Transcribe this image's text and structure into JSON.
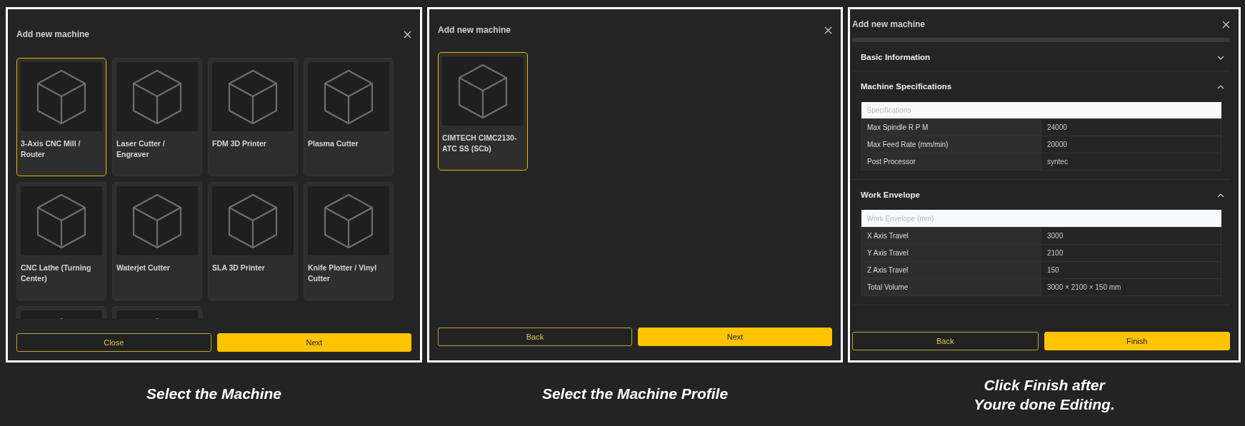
{
  "panels": [
    {
      "kind": "card_grid",
      "title": "Add new machine",
      "cards": [
        {
          "label": "3-Axis CNC Mill / Router",
          "selected": true
        },
        {
          "label": "Laser Cutter / Engraver",
          "selected": false
        },
        {
          "label": "FDM 3D Printer",
          "selected": false
        },
        {
          "label": "Plasma Cutter",
          "selected": false
        },
        {
          "label": "CNC Lathe (Turning Center)",
          "selected": false
        },
        {
          "label": "Waterjet Cutter",
          "selected": false
        },
        {
          "label": "SLA 3D Printer",
          "selected": false
        },
        {
          "label": "Knife Plotter / Vinyl Cutter",
          "selected": false
        },
        {
          "selected": false
        },
        {
          "selected": false
        }
      ],
      "buttons": [
        {
          "label": "Close",
          "kind": "outline"
        },
        {
          "label": "Next",
          "kind": "primary"
        }
      ],
      "caption": [
        "Select the Machine"
      ]
    },
    {
      "kind": "card_grid",
      "title": "Add new machine",
      "cards": [
        {
          "label": "CIMTECH CIMC2130-ATC SS (SCb)",
          "selected": true
        }
      ],
      "buttons": [
        {
          "label": "Back",
          "kind": "outline"
        },
        {
          "label": "Next",
          "kind": "primary"
        }
      ],
      "caption": [
        "Select the Machine Profile"
      ]
    },
    {
      "kind": "details",
      "title": "Add new machine",
      "sections": [
        {
          "title": "Basic Information",
          "expanded": false
        },
        {
          "title": "Machine Specifications",
          "expanded": true,
          "table": {
            "header": "Specifications",
            "rows": [
              [
                "Max Spindle R P M",
                "24000"
              ],
              [
                "Max Feed Rate (mm/min)",
                "20000"
              ],
              [
                "Post Processor",
                "syntec"
              ]
            ]
          }
        },
        {
          "title": "Work Envelope",
          "expanded": true,
          "table": {
            "header": "Work Envelope (mm)",
            "rows": [
              [
                "X Axis Travel",
                "3000"
              ],
              [
                "Y Axis Travel",
                "2100"
              ],
              [
                "Z Axis Travel",
                "150"
              ],
              [
                "Total Volume",
                "3000 × 2100 × 150 mm"
              ]
            ]
          }
        }
      ],
      "buttons": [
        {
          "label": "Back",
          "kind": "outline"
        },
        {
          "label": "Finish",
          "kind": "primary"
        }
      ],
      "caption": [
        "Click Finish after",
        "Youre done Editing."
      ]
    }
  ]
}
